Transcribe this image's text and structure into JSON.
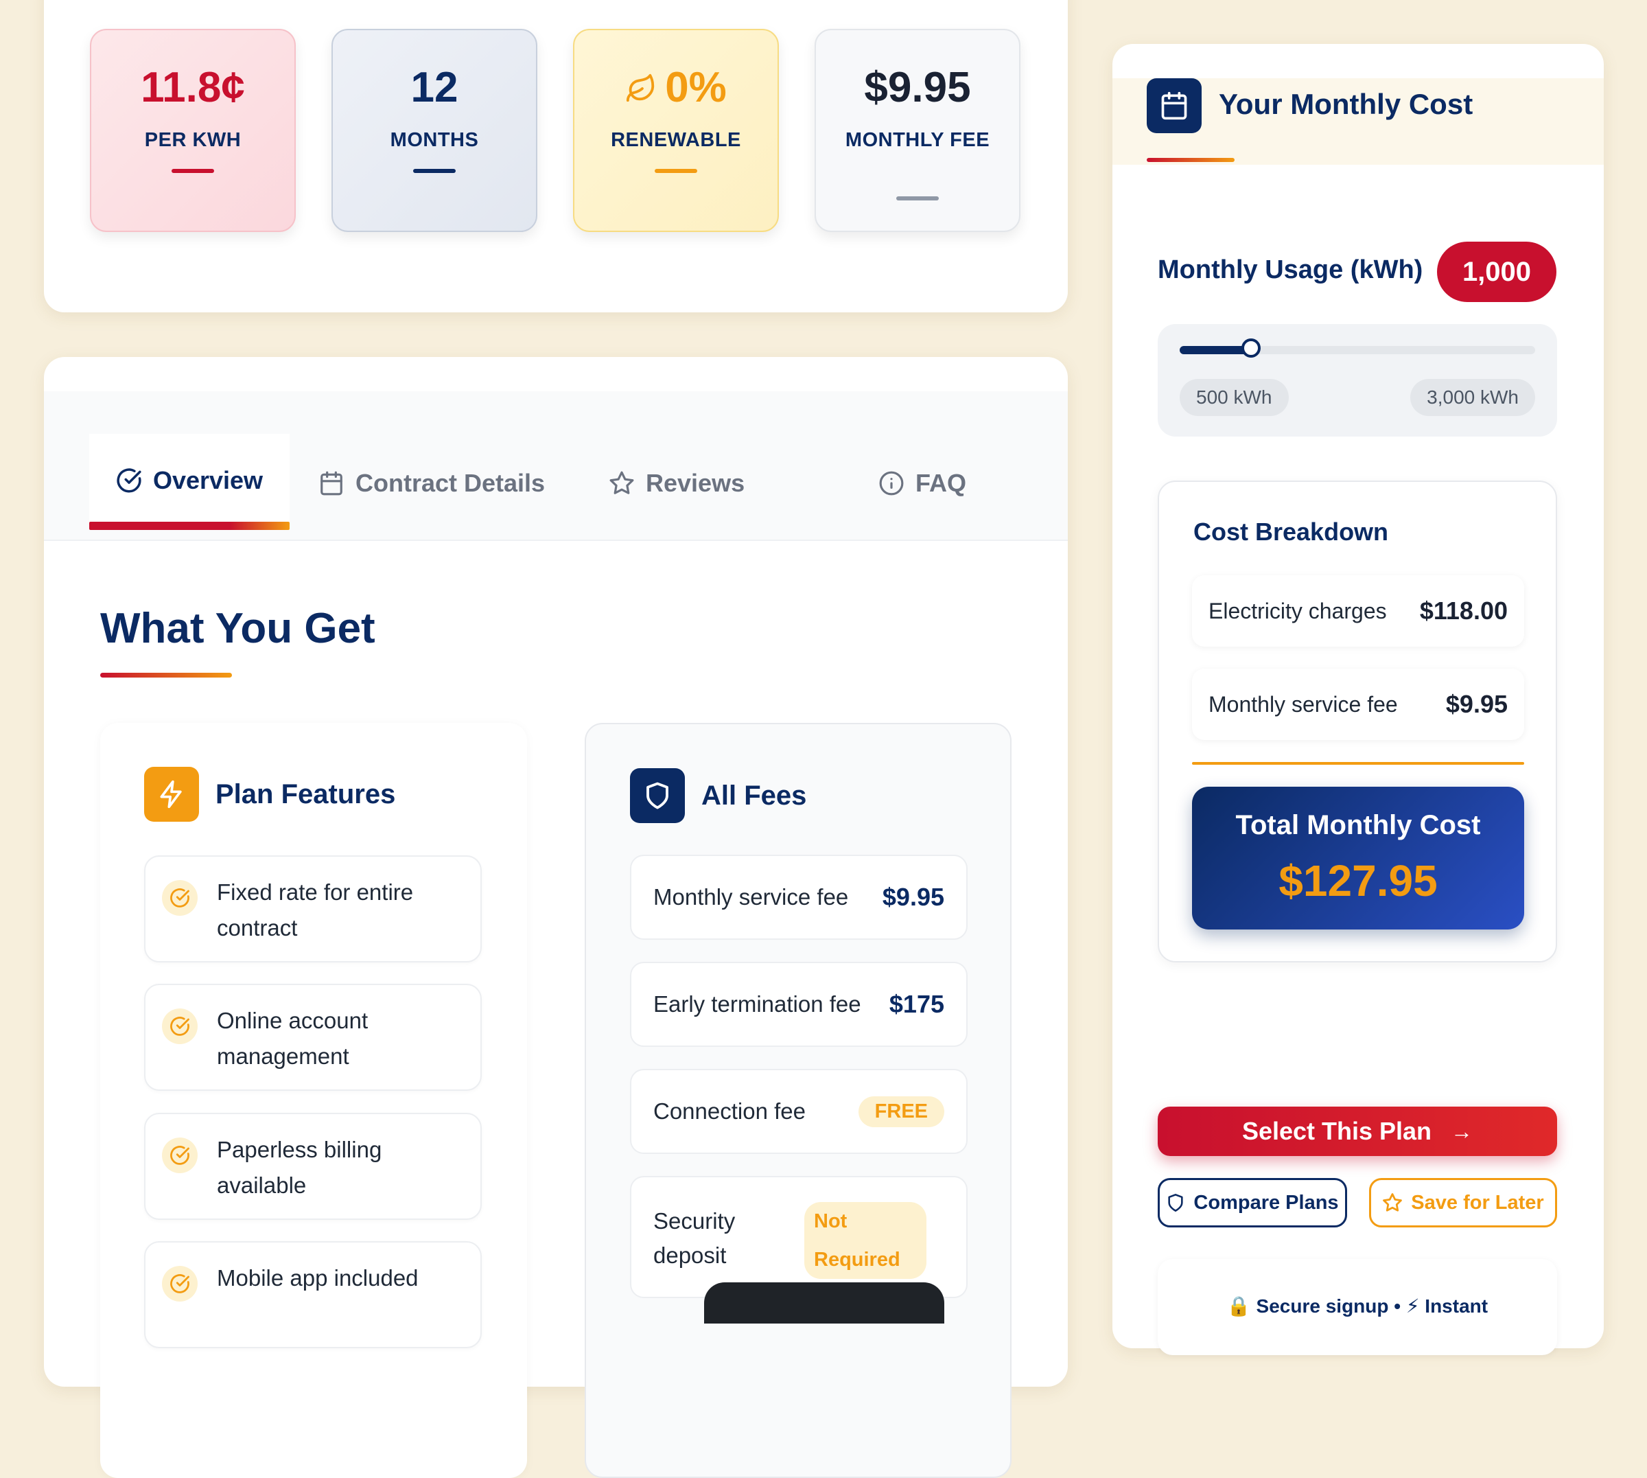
{
  "stats": [
    {
      "value": "11.8¢",
      "label": "PER KWH"
    },
    {
      "value": "12",
      "label": "MONTHS"
    },
    {
      "value": "0%",
      "label": "RENEWABLE",
      "icon": "leaf-icon"
    },
    {
      "value": "$9.95",
      "label": "MONTHLY FEE"
    }
  ],
  "tabs": [
    {
      "label": "Overview",
      "icon": "check-circle-icon",
      "active": true
    },
    {
      "label": "Contract Details",
      "icon": "calendar-icon"
    },
    {
      "label": "Reviews",
      "icon": "star-icon"
    },
    {
      "label": "FAQ",
      "icon": "info-icon"
    }
  ],
  "section": {
    "title": "What You Get"
  },
  "features": {
    "title": "Plan Features",
    "icon": "lightning-icon",
    "items": [
      "Fixed rate for entire contract",
      "Online account management",
      "Paperless billing available",
      "Mobile app included"
    ]
  },
  "fees": {
    "title": "All Fees",
    "icon": "shield-icon",
    "items": [
      {
        "name": "Monthly service fee",
        "amount": "$9.95"
      },
      {
        "name": "Early termination fee",
        "amount": "$175"
      },
      {
        "name": "Connection fee",
        "badge": "FREE"
      },
      {
        "name": "Security deposit",
        "badge": "Not Required"
      }
    ]
  },
  "cost": {
    "title": "Your Monthly Cost",
    "usage_label": "Monthly Usage (kWh)",
    "usage_value": "1,000",
    "slider": {
      "min_label": "500 kWh",
      "max_label": "3,000 kWh",
      "min": 500,
      "max": 3000,
      "value": 1000
    },
    "breakdown_title": "Cost Breakdown",
    "breakdown": [
      {
        "name": "Electricity charges",
        "amount": "$118.00"
      },
      {
        "name": "Monthly service fee",
        "amount": "$9.95"
      }
    ],
    "total_label": "Total Monthly Cost",
    "total_amount": "$127.95",
    "select_label": "Select This Plan",
    "compare_label": "Compare Plans",
    "save_label": "Save for Later",
    "trust_text": "🔒 Secure signup • ⚡ Instant"
  },
  "colors": {
    "brand_red": "#c8102e",
    "brand_navy": "#0b2a63",
    "accent_orange": "#f39c12"
  }
}
